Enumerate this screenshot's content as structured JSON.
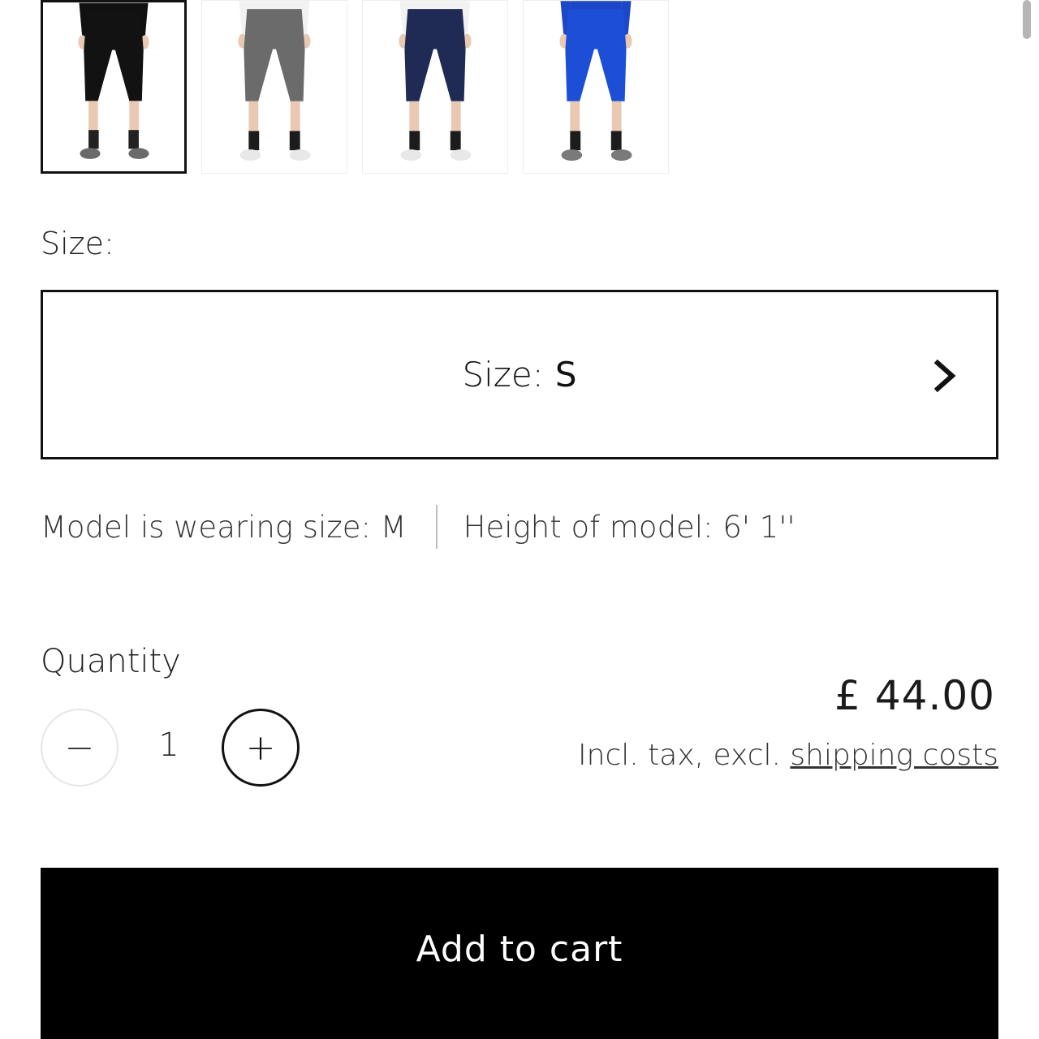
{
  "gallery": {
    "thumbnails": [
      {
        "name": "thumbnail-black",
        "top_color": "#111111",
        "leg_color": "#121212",
        "sock_color": "#222222",
        "shoe_color": "#6a6a6a",
        "selected": true
      },
      {
        "name": "thumbnail-grey",
        "top_color": "#f2f2f2",
        "leg_color": "#6b6b6b",
        "sock_color": "#1c1c1c",
        "shoe_color": "#e8e8e8",
        "selected": false
      },
      {
        "name": "thumbnail-navy",
        "top_color": "#f2f2f2",
        "leg_color": "#1f2a55",
        "sock_color": "#1c1c1c",
        "shoe_color": "#e8e8e8",
        "selected": false
      },
      {
        "name": "thumbnail-blue",
        "top_color": "#1d47c9",
        "leg_color": "#1c4fd6",
        "sock_color": "#1c1c1c",
        "shoe_color": "#7a7a7a",
        "selected": false
      }
    ]
  },
  "size": {
    "label": "Size:",
    "selector_label": "Size:",
    "selected_value": "S"
  },
  "model_info": {
    "wearing": "Model is wearing size: M",
    "height": "Height of model: 6' 1''"
  },
  "quantity": {
    "label": "Quantity",
    "minus": "−",
    "value": "1",
    "plus": "+"
  },
  "price": {
    "amount": "£ 44.00",
    "tax_prefix": "Incl. tax, excl. ",
    "shipping_link": "shipping costs"
  },
  "cart": {
    "button_label": "Add to cart"
  },
  "colors": {
    "accent": "#000000",
    "border": "#111111"
  }
}
